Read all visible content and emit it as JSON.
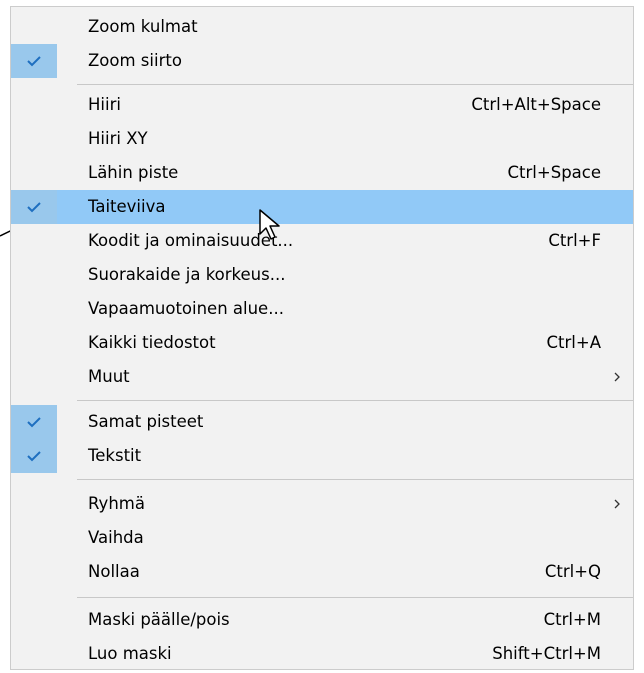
{
  "menu": {
    "items": [
      {
        "label": "Zoom kulmat",
        "shortcut": "",
        "checked": false
      },
      {
        "label": "Zoom siirto",
        "shortcut": "",
        "checked": true
      },
      {
        "label": "Hiiri",
        "shortcut": "Ctrl+Alt+Space",
        "checked": false
      },
      {
        "label": "Hiiri XY",
        "shortcut": "",
        "checked": false
      },
      {
        "label": "Lähin piste",
        "shortcut": "Ctrl+Space",
        "checked": false
      },
      {
        "label": "Taiteviiva",
        "shortcut": "",
        "checked": true,
        "selected": true
      },
      {
        "label": "Koodit ja ominaisuudet...",
        "shortcut": "Ctrl+F",
        "checked": false
      },
      {
        "label": "Suorakaide ja korkeus...",
        "shortcut": "",
        "checked": false
      },
      {
        "label": "Vapaamuotoinen alue...",
        "shortcut": "",
        "checked": false
      },
      {
        "label": "Kaikki tiedostot",
        "shortcut": "Ctrl+A",
        "checked": false
      },
      {
        "label": "Muut",
        "shortcut": "",
        "checked": false,
        "submenu": true
      },
      {
        "label": "Samat pisteet",
        "shortcut": "",
        "checked": true
      },
      {
        "label": "Tekstit",
        "shortcut": "",
        "checked": true
      },
      {
        "label": "Ryhmä",
        "shortcut": "",
        "checked": false,
        "submenu": true
      },
      {
        "label": "Vaihda",
        "shortcut": "",
        "checked": false
      },
      {
        "label": "Nollaa",
        "shortcut": "Ctrl+Q",
        "checked": false
      },
      {
        "label": "Maski päälle/pois",
        "shortcut": "Ctrl+M",
        "checked": false
      },
      {
        "label": "Luo maski",
        "shortcut": "Shift+Ctrl+M",
        "checked": false
      }
    ]
  },
  "colors": {
    "menu_background": "#f2f2f2",
    "selection": "#91c9f7",
    "check_background": "#99c8ec",
    "check_mark": "#1e6fc0",
    "separator": "#c8c8c8"
  },
  "icons": {
    "check": "check-icon",
    "submenu": "chevron-right-icon",
    "cursor": "mouse-cursor-icon",
    "annotation": "annotation-arrow-icon"
  }
}
